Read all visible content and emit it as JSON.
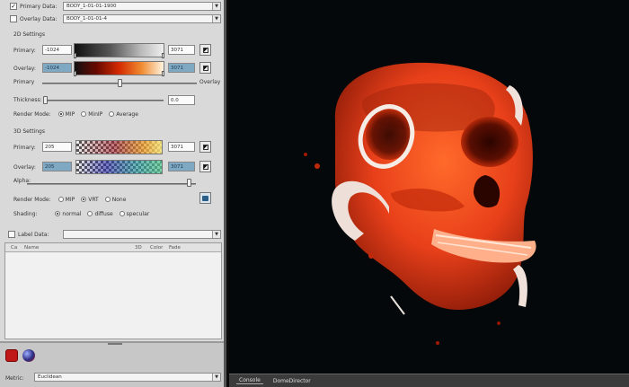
{
  "primary_data": {
    "checked": true,
    "label": "Primary Data:",
    "value": "BODY_1-01-01-1900"
  },
  "overlay_data": {
    "checked": false,
    "label": "Overlay Data:",
    "value": "BODY_1-01-01-4"
  },
  "settings_2d": {
    "title": "2D Settings",
    "primary_label": "Primary:",
    "primary_min": "-1024",
    "primary_max": "3071",
    "overlay_label": "Overlay:",
    "overlay_min": "-1024",
    "overlay_max": "3071",
    "mix_left": "Primary",
    "mix_right": "Overlay",
    "thickness_label": "Thickness:",
    "thickness_value": "0.0",
    "render_label": "Render Mode:",
    "render_modes": [
      "MIP",
      "MinIP",
      "Average"
    ],
    "render_selected": "MIP"
  },
  "settings_3d": {
    "title": "3D Settings",
    "primary_label": "Primary:",
    "primary_min": "205",
    "primary_max": "3071",
    "overlay_label": "Overlay:",
    "overlay_min": "205",
    "overlay_max": "3071",
    "alpha_label": "Alpha:",
    "render_label": "Render Mode:",
    "render_modes": [
      "MIP",
      "VRT",
      "None"
    ],
    "render_selected": "VRT",
    "shading_label": "Shading:",
    "shading_modes": [
      "normal",
      "diffuse",
      "specular"
    ],
    "shading_selected": "normal"
  },
  "label_data": {
    "checked": false,
    "label": "Label Data:",
    "value": ""
  },
  "label_table": {
    "columns": [
      "Ca",
      "Name",
      "3D",
      "Color",
      "Fade"
    ]
  },
  "bottom": {
    "label": "Metric:",
    "value": "Euclidean"
  },
  "status_tabs": [
    "Console",
    "DomeDirector"
  ],
  "icons": [
    "checkmark-icon",
    "dropdown-arrow-icon",
    "colormap-icon",
    "camera-icon",
    "tool-red-icon",
    "tool-orb-icon"
  ],
  "colors": {
    "panel": "#d9d9d9",
    "accent_blue": "#7fa8c2",
    "render_bg": "#05080a",
    "bone_hot": "#e8401a"
  }
}
